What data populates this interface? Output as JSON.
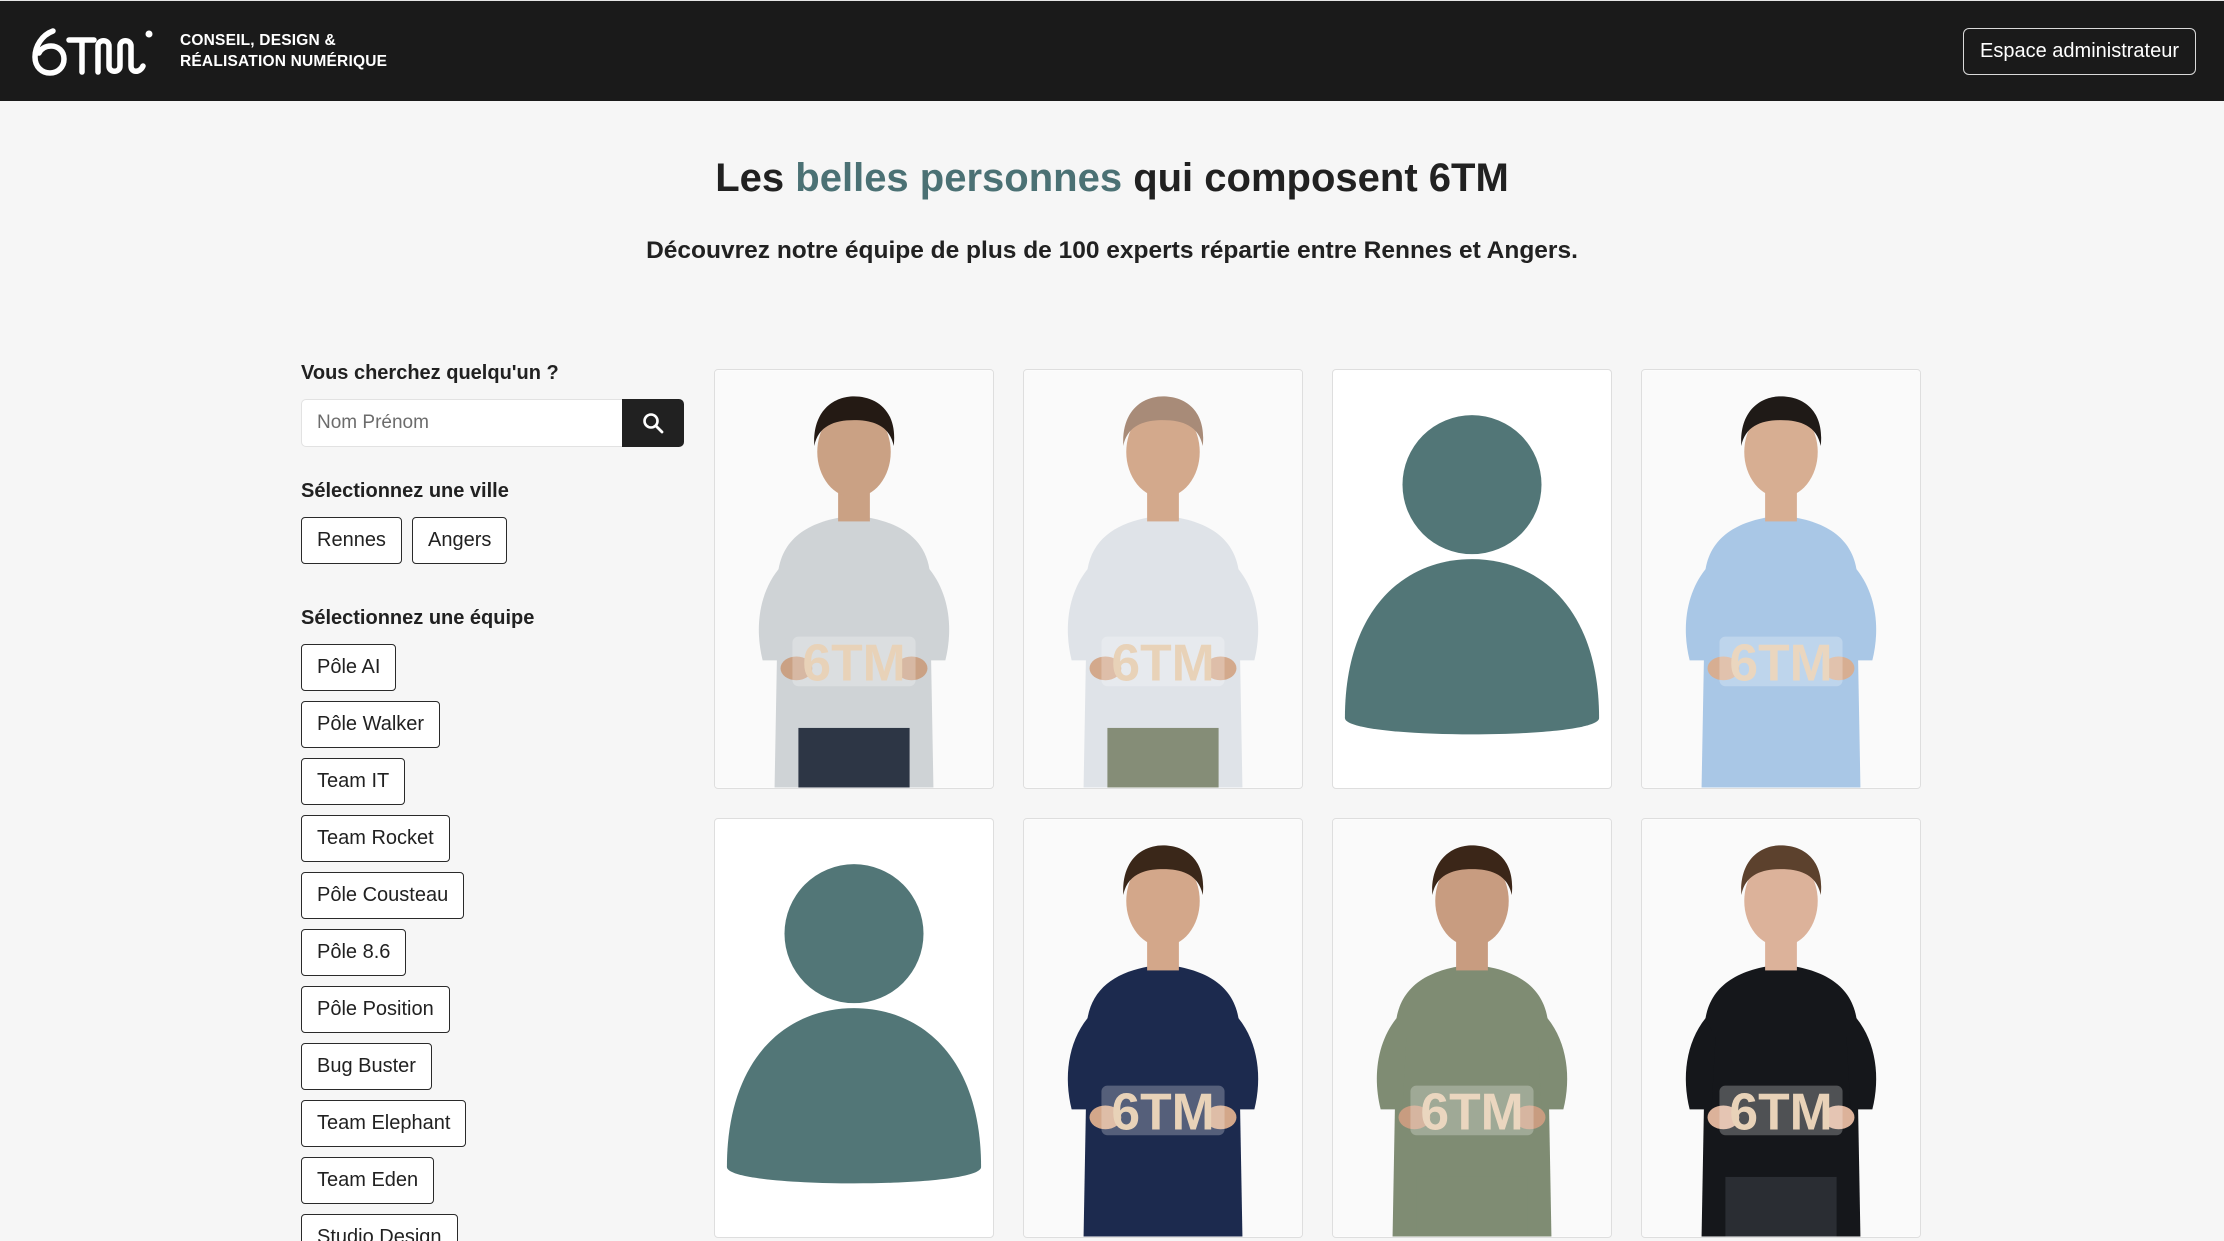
{
  "header": {
    "logo_text": "6TM",
    "tagline_line1": "CONSEIL, DESIGN &",
    "tagline_line2": "RÉALISATION NUMÉRIQUE",
    "admin_button": "Espace administrateur"
  },
  "hero": {
    "title_prefix": "Les ",
    "title_accent": "belles personnes",
    "title_suffix": " qui composent 6TM",
    "subtitle": "Découvrez notre équipe de plus de 100 experts répartie entre Rennes et Angers."
  },
  "sidebar": {
    "search_label": "Vous cherchez quelqu'un ?",
    "search_placeholder": "Nom Prénom",
    "city_label": "Sélectionnez une ville",
    "cities": [
      "Rennes",
      "Angers"
    ],
    "team_label": "Sélectionnez une équipe",
    "teams": [
      "Pôle AI",
      "Pôle Walker",
      "Team IT",
      "Team Rocket",
      "Pôle Cousteau",
      "Pôle 8.6",
      "Pôle Position",
      "Bug Buster",
      "Team Elephant",
      "Team Eden",
      "Studio Design"
    ]
  },
  "colors": {
    "accent": "#4b7174",
    "header_bg": "#1a1a1a",
    "page_bg": "#f6f6f6",
    "placeholder_avatar": "#527677"
  },
  "team_cards": [
    {
      "kind": "photo",
      "shirt": "#cfd3d6",
      "hair": "#241a14",
      "pants": "#2d3645",
      "skin": "#caa184",
      "sign_color": "#e8d2b8"
    },
    {
      "kind": "photo",
      "shirt": "#dfe3e8",
      "hair": "#a88b78",
      "pants": "#858d77",
      "skin": "#d3a98c",
      "sign_color": "#e8d2b8"
    },
    {
      "kind": "placeholder"
    },
    {
      "kind": "photo",
      "shirt": "#a9c7e6",
      "hair": "#1f1a17",
      "pants": "#a9c7e6",
      "skin": "#d7ae92",
      "sign_color": "#ead6bf"
    },
    {
      "kind": "placeholder"
    },
    {
      "kind": "photo",
      "shirt": "#1c2a4e",
      "hair": "#3a2719",
      "pants": "#1c2a4e",
      "skin": "#d3a78a",
      "sign_color": "#e8d2b8"
    },
    {
      "kind": "photo",
      "shirt": "#7f8c73",
      "hair": "#3b2618",
      "pants": "#7f8c73",
      "skin": "#c89c80",
      "sign_color": "#ead6bf"
    },
    {
      "kind": "photo",
      "shirt": "#15171b",
      "hair": "#5c412d",
      "pants": "#2a2d33",
      "skin": "#dcb29a",
      "sign_color": "#e8d2b8"
    }
  ]
}
